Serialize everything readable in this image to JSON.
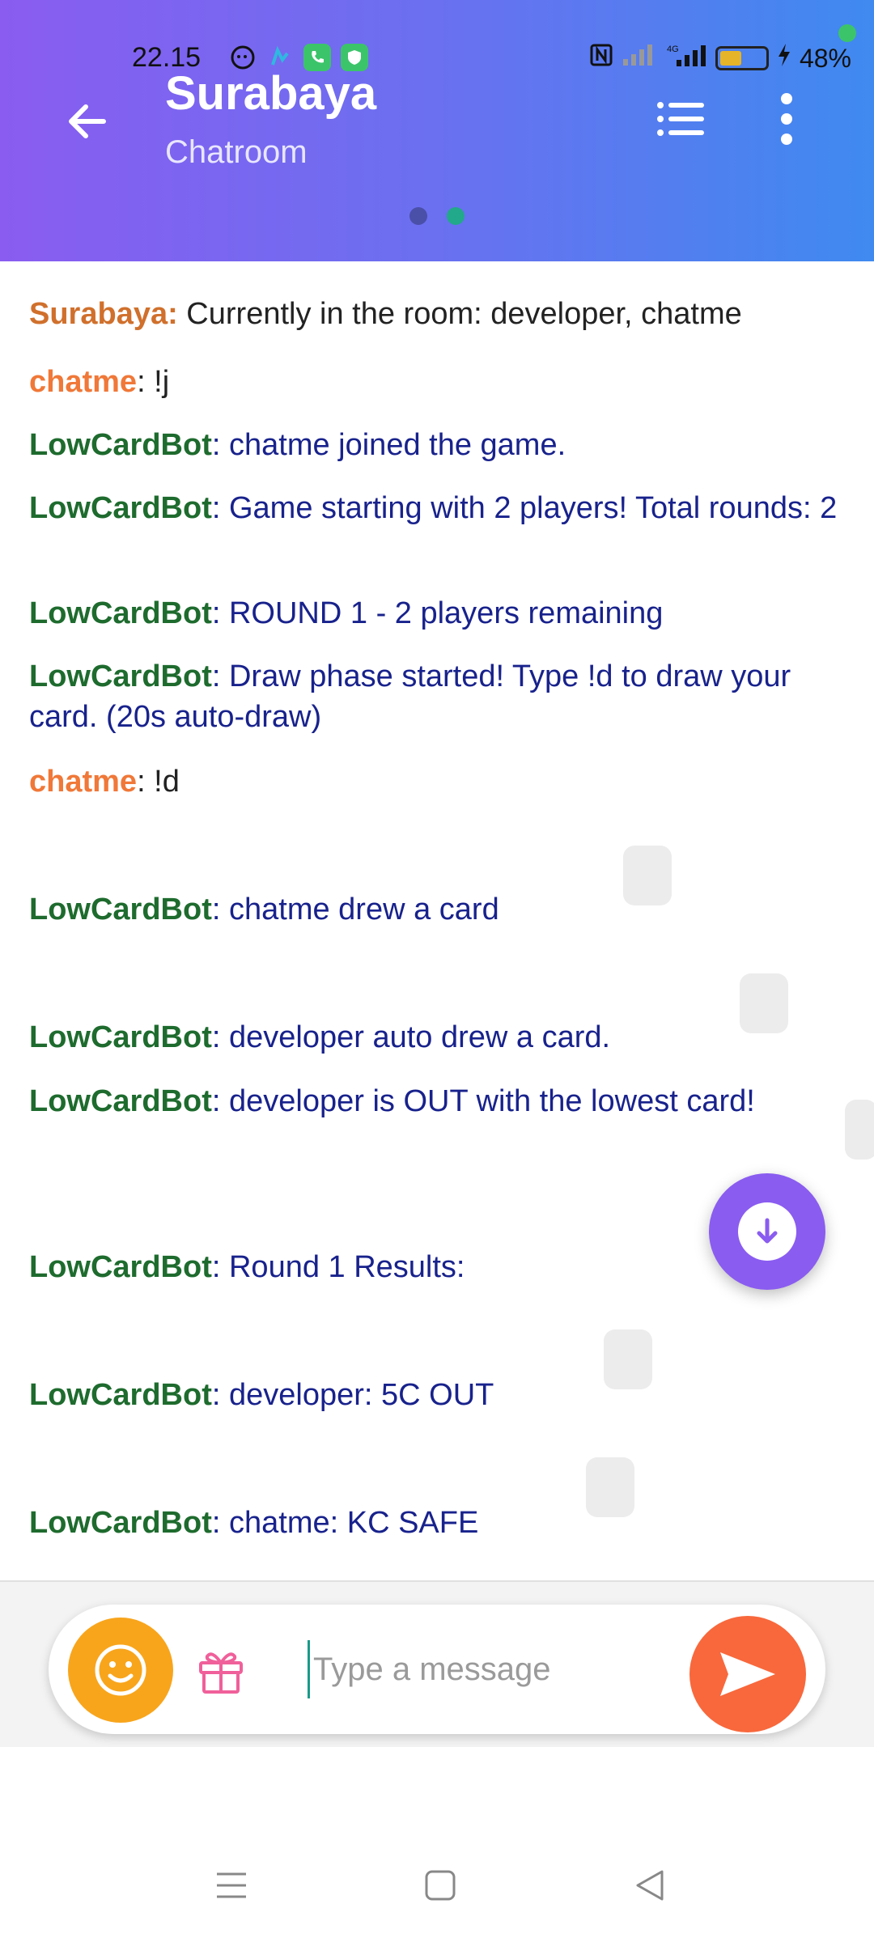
{
  "status_bar": {
    "time": "22.15",
    "battery_percent": "48%",
    "battery_level": 0.48,
    "network": "4G"
  },
  "header": {
    "title": "Surabaya",
    "subtitle": "Chatroom",
    "pager": {
      "count": 2,
      "active_index": 1
    }
  },
  "messages": [
    {
      "sender": "Surabaya:",
      "text": " Currently in the room: developer, chatme",
      "kind": "room"
    },
    {
      "sender": "chatme",
      "text": ": !j",
      "kind": "user"
    },
    {
      "sender": "LowCardBot",
      "text": ": chatme joined the game.",
      "kind": "bot"
    },
    {
      "sender": "LowCardBot",
      "text": ": Game starting with 2 players! Total rounds: 2",
      "kind": "bot"
    },
    {
      "sender": "LowCardBot",
      "text": ": ROUND 1 - 2 players remaining",
      "kind": "bot"
    },
    {
      "sender": "LowCardBot",
      "text": ": Draw phase started! Type !d to draw your card. (20s auto-draw)",
      "kind": "bot"
    },
    {
      "sender": "chatme",
      "text": ": !d",
      "kind": "user"
    },
    {
      "sender": "LowCardBot",
      "text": ": chatme drew a card",
      "kind": "bot"
    },
    {
      "sender": "LowCardBot",
      "text": ": developer auto drew a card.",
      "kind": "bot"
    },
    {
      "sender": "LowCardBot",
      "text": ": developer is OUT with the lowest card!",
      "kind": "bot"
    },
    {
      "sender": "LowCardBot",
      "text": ": Round 1 Results:",
      "kind": "bot"
    },
    {
      "sender": "LowCardBot",
      "text": ": developer: 5C OUT",
      "kind": "bot"
    },
    {
      "sender": "LowCardBot",
      "text": ": chatme: KC SAFE",
      "kind": "bot"
    }
  ],
  "composer": {
    "placeholder": "Type a message"
  },
  "colors": {
    "header_gradient_start": "#8a5cf0",
    "header_gradient_end": "#3f8af0",
    "bot_name": "#1e6b2e",
    "bot_text": "#18228c",
    "user_name": "#f07838",
    "emoji_button": "#f8a51c",
    "send_button": "#f8683c",
    "scroll_button": "#8a5cf0"
  },
  "icons": {
    "back": "arrow-left-icon",
    "list": "list-icon",
    "more": "more-vertical-icon",
    "emoji": "smiley-icon",
    "gift": "gift-icon",
    "send": "send-icon",
    "scroll": "arrow-down-icon"
  }
}
